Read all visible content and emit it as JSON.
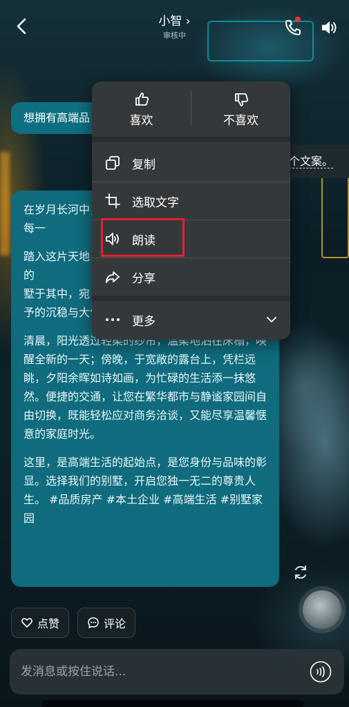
{
  "header": {
    "title": "小智",
    "title_chevron": "›",
    "subtitle": "审核中",
    "back_icon": "chevron-left-icon",
    "call_icon": "phone-icon",
    "sound_icon": "speaker-icon",
    "notify_color": "#ff2b3a"
  },
  "chat": {
    "user_message": "想拥有高端品",
    "side_fragment": "个文案。",
    "ai_paragraphs": [
      "在岁月长河中，　　　　　　　　　　　匠心雕琢每一　　　　　　　　　　　家园。",
      "踏入这片天地　　　　　　　　　　　仙境。葱郁的　　　　　　　　　　　自然的低语，　　　　　　　　　　　墅于其中，宛　　　　　　　　　　　发着岁月赋予的沉稳与大气。",
      "清晨，阳光透过轻柔的纱帘，温柔地洒在床榻，唤醒全新的一天；傍晚，于宽敞的露台上，凭栏远眺，夕阳余晖如诗如画，为忙碌的生活添一抹悠然。便捷的交通，让您在繁华都市与静谧家园间自由切换，既能轻松应对商务洽谈，又能尽享温馨惬意的家庭时光。",
      "这里，是高端生活的起始点，是您身份与品味的彰显。选择我们的别墅，开启您独一无二的尊贵人生。 #品质房产 #本土企业 #高端生活 #别墅家园"
    ],
    "bubble_color": "#0f6b7d"
  },
  "actions": {
    "like_label": "点赞",
    "comment_label": "评论"
  },
  "input": {
    "placeholder": "发消息或按住说话..."
  },
  "menu": {
    "like": "喜欢",
    "dislike": "不喜欢",
    "copy": "复制",
    "select_text": "选取文字",
    "read_aloud": "朗读",
    "share": "分享",
    "more": "更多",
    "highlight_color": "#e5212e"
  }
}
